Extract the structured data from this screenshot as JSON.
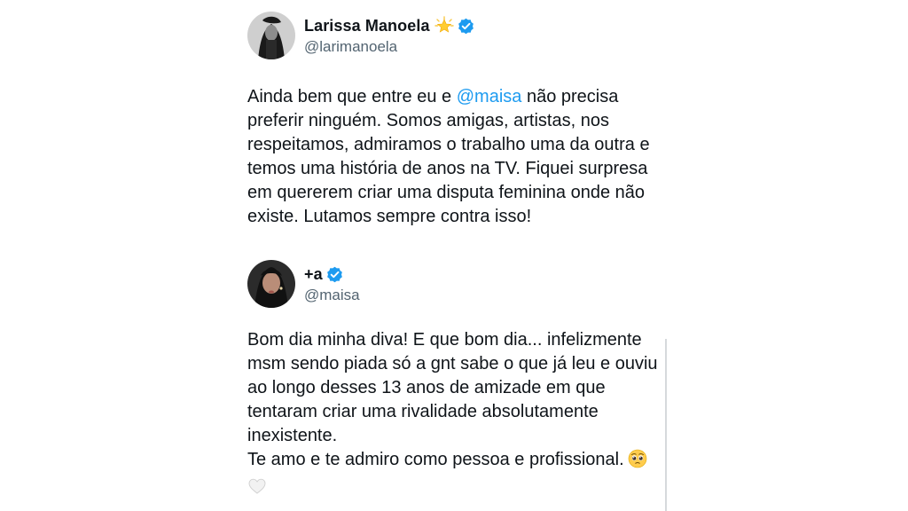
{
  "tweets": [
    {
      "display_name": "Larissa Manoela",
      "handle": "@larimanoela",
      "name_emoji": "glowing-star",
      "verified": true,
      "text": {
        "l1_before": "Ainda bem que entre eu e ",
        "l1_mention": "@maisa",
        "l1_after": " não precisa",
        "l2": "preferir ninguém. Somos amigas, artistas, nos",
        "l3": "respeitamos, admiramos o trabalho uma da outra e",
        "l4": "temos uma história de anos na TV. Fiquei surpresa",
        "l5": "em quererem criar uma disputa feminina onde não",
        "l6": "existe. Lutamos sempre contra isso!"
      }
    },
    {
      "display_name": "+a",
      "handle": "@maisa",
      "verified": true,
      "text": {
        "l1": "Bom dia minha diva! E que bom dia... infelizmente",
        "l2": "msm sendo piada só a gnt sabe o que já leu e ouviu",
        "l3": "ao longo desses 13 anos de amizade em que",
        "l4": "tentaram criar uma rivalidade absolutamente",
        "l5": "inexistente.",
        "l6": "Te amo e te admiro como pessoa e profissional.",
        "l6_emoji": "pleading-face",
        "l7_emoji": "white-heart"
      }
    }
  ],
  "colors": {
    "text": "#0f1419",
    "secondary": "#536471",
    "mention": "#1d9bf0",
    "verified": "#1d9bf0",
    "background": "#ffffff"
  }
}
